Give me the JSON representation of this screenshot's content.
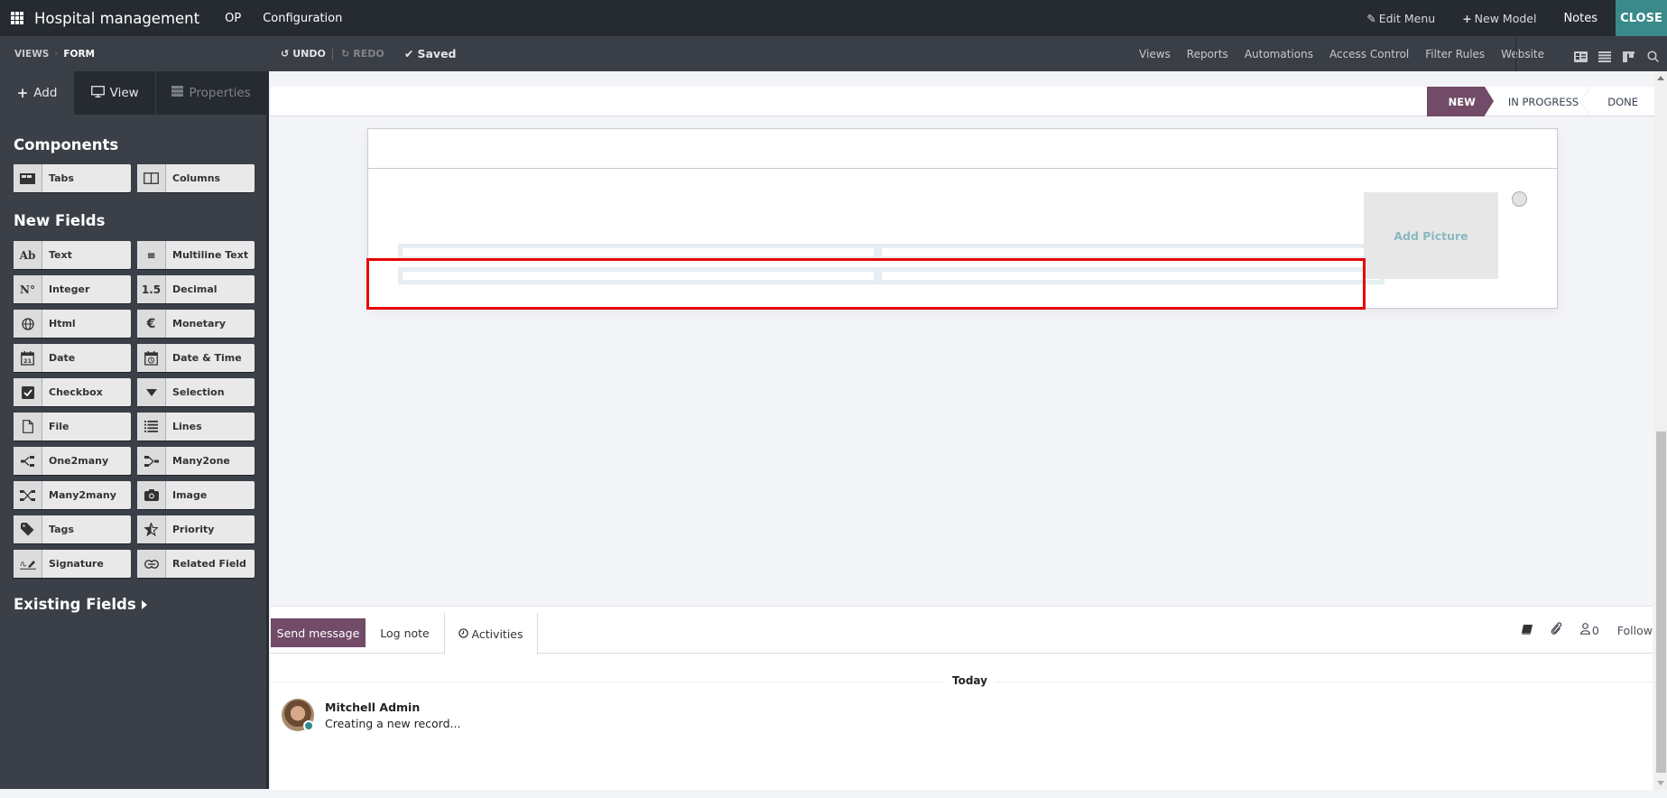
{
  "topbar": {
    "app_title": "Hospital management",
    "menus": [
      "OP",
      "Configuration"
    ],
    "edit_menu": "Edit Menu",
    "new_model": "New Model",
    "notes": "Notes",
    "close": "CLOSE"
  },
  "subbar": {
    "breadcrumb": [
      "VIEWS",
      "FORM"
    ],
    "undo": "UNDO",
    "redo": "REDO",
    "saved": "Saved",
    "links": [
      "Views",
      "Reports",
      "Automations",
      "Access Control",
      "Filter Rules",
      "Website"
    ],
    "view_icons": [
      "form-view-icon",
      "list-view-icon",
      "kanban-view-icon",
      "search-icon"
    ]
  },
  "sidebar": {
    "tabs": {
      "add": "Add",
      "view": "View",
      "properties": "Properties"
    },
    "components_title": "Components",
    "components": [
      {
        "label": "Tabs",
        "icon": "tabs-icon"
      },
      {
        "label": "Columns",
        "icon": "columns-icon"
      }
    ],
    "new_fields_title": "New Fields",
    "new_fields": [
      {
        "label": "Text",
        "icon": "Ab"
      },
      {
        "label": "Multiline Text",
        "icon": "≡"
      },
      {
        "label": "Integer",
        "icon": "N°"
      },
      {
        "label": "Decimal",
        "icon": "1.5"
      },
      {
        "label": "Html",
        "icon": "🌐"
      },
      {
        "label": "Monetary",
        "icon": "€"
      },
      {
        "label": "Date",
        "icon": "21"
      },
      {
        "label": "Date & Time",
        "icon": "◷"
      },
      {
        "label": "Checkbox",
        "icon": "☑"
      },
      {
        "label": "Selection",
        "icon": "▼"
      },
      {
        "label": "File",
        "icon": "🗋"
      },
      {
        "label": "Lines",
        "icon": "☰"
      },
      {
        "label": "One2many",
        "icon": "⊰"
      },
      {
        "label": "Many2one",
        "icon": "⊱"
      },
      {
        "label": "Many2many",
        "icon": "⤨"
      },
      {
        "label": "Image",
        "icon": "📷"
      },
      {
        "label": "Tags",
        "icon": "🏷"
      },
      {
        "label": "Priority",
        "icon": "★"
      },
      {
        "label": "Signature",
        "icon": "✍"
      },
      {
        "label": "Related Field",
        "icon": "⊂⊃"
      }
    ],
    "existing_fields_title": "Existing Fields"
  },
  "form": {
    "stages": [
      "NEW",
      "IN PROGRESS",
      "DONE"
    ],
    "active_stage": "NEW",
    "add_picture": "Add Picture"
  },
  "chatter": {
    "send_message": "Send message",
    "log_note": "Log note",
    "activities": "Activities",
    "follower_count": "0",
    "follow": "Follow",
    "date_separator": "Today",
    "messages": [
      {
        "author": "Mitchell Admin",
        "body": "Creating a new record..."
      }
    ]
  },
  "colors": {
    "brand": "#714b67",
    "close_button": "#3a8a8a",
    "highlight": "#e80000"
  }
}
